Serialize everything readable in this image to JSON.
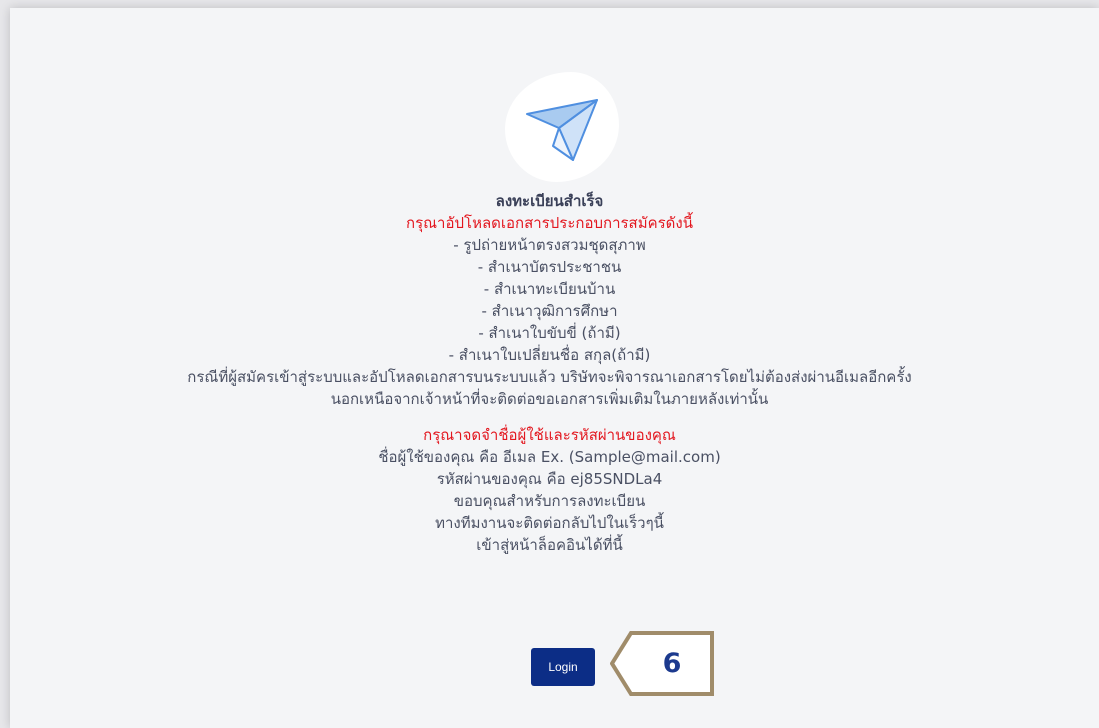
{
  "icon": "paper-plane-icon",
  "messages": {
    "title": "ลงทะเบียนสำเร็จ",
    "upload_heading": "กรุณาอัปโหลดเอกสารประกอบการสมัครดังนี้",
    "documents": [
      "- รูปถ่ายหน้าตรงสวมชุดสุภาพ",
      "- สำเนาบัตรประชาชน",
      "- สำเนาทะเบียนบ้าน",
      "- สำเนาวุฒิการศึกษา",
      "- สำเนาใบขับขี่ (ถ้ามี)",
      "- สำเนาใบเปลี่ยนชื่อ สกุล(ถ้ามี)"
    ],
    "note_line1": "กรณีที่ผู้สมัครเข้าสู่ระบบและอัปโหลดเอกสารบนระบบแล้ว บริษัทจะพิจารณาเอกสารโดยไม่ต้องส่งผ่านอีเมลอีกครั้ง",
    "note_line2": "นอกเหนือจากเจ้าหน้าที่จะติดต่อขอเอกสารเพิ่มเติมในภายหลังเท่านั้น",
    "remember_heading": "กรุณาจดจำชื่อผู้ใช้และรหัสผ่านของคุณ",
    "username_line": "ชื่อผู้ใช้ของคุณ คือ อีเมล Ex. (Sample@mail.com)",
    "password_line": "รหัสผ่านของคุณ คือ ej85SNDLa4",
    "thanks_line": "ขอบคุณสำหรับการลงทะเบียน",
    "contact_line": "ทางทีมงานจะติดต่อกลับไปในเร็วๆนี้",
    "login_prompt": "เข้าสู่หน้าล็อคอินได้ที่นี้"
  },
  "login_button": {
    "label": "Login"
  },
  "callout": {
    "number": "6",
    "border_color": "#a08c6a",
    "text_color": "#1c3a8e"
  },
  "colors": {
    "accent_red": "#e3171f",
    "button_blue": "#0c2d86",
    "text": "#4a5063"
  }
}
